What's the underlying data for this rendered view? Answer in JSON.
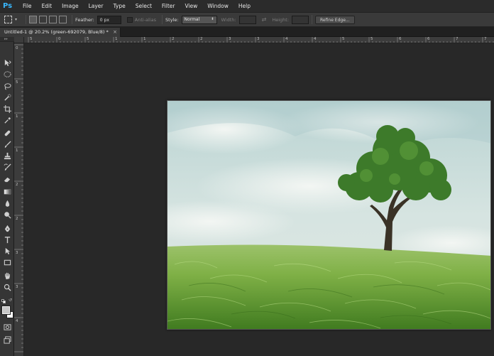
{
  "app": {
    "logo_text": "Ps",
    "accent_color": "#39b8ff"
  },
  "menu": {
    "items": [
      "File",
      "Edit",
      "Image",
      "Layer",
      "Type",
      "Select",
      "Filter",
      "View",
      "Window",
      "Help"
    ]
  },
  "options": {
    "feather_label": "Feather:",
    "feather_value": "0 px",
    "anti_alias_label": "Anti-alias",
    "style_label": "Style:",
    "style_value": "Normal",
    "width_label": "Width:",
    "height_label": "Height:",
    "refine_edge_label": "Refine Edge..."
  },
  "document_tab": {
    "title": "Untitled-1 @ 20.2% (green-692079, Blue/8) *",
    "close_glyph": "×"
  },
  "rulers": {
    "top_numbers": [
      "5",
      "0",
      "5",
      "1",
      "1",
      "2",
      "2",
      "3",
      "3",
      "4",
      "4",
      "5",
      "5",
      "6",
      "6",
      "7",
      "7"
    ],
    "left_numbers": [
      "0",
      "5",
      "1",
      "1",
      "2",
      "2",
      "3",
      "3",
      "4"
    ]
  },
  "tools": [
    {
      "name": "move-tool",
      "icon": "move-icon"
    },
    {
      "name": "marquee-tool",
      "icon": "ellipse-marquee-icon"
    },
    {
      "name": "lasso-tool",
      "icon": "lasso-icon"
    },
    {
      "name": "quick-selection-tool",
      "icon": "quick-selection-icon"
    },
    {
      "name": "crop-tool",
      "icon": "crop-icon"
    },
    {
      "name": "eyedropper-tool",
      "icon": "eyedropper-icon"
    },
    {
      "name": "healing-brush-tool",
      "icon": "bandage-icon"
    },
    {
      "name": "brush-tool",
      "icon": "brush-icon"
    },
    {
      "name": "clone-stamp-tool",
      "icon": "stamp-icon"
    },
    {
      "name": "history-brush-tool",
      "icon": "history-brush-icon"
    },
    {
      "name": "eraser-tool",
      "icon": "eraser-icon"
    },
    {
      "name": "gradient-tool",
      "icon": "gradient-icon"
    },
    {
      "name": "blur-tool",
      "icon": "droplet-icon"
    },
    {
      "name": "dodge-tool",
      "icon": "dodge-icon"
    },
    {
      "name": "pen-tool",
      "icon": "pen-icon"
    },
    {
      "name": "type-tool",
      "icon": "type-icon"
    },
    {
      "name": "path-selection-tool",
      "icon": "arrow-icon"
    },
    {
      "name": "rectangle-tool",
      "icon": "rectangle-icon"
    },
    {
      "name": "hand-tool",
      "icon": "hand-icon"
    },
    {
      "name": "zoom-tool",
      "icon": "zoom-icon"
    }
  ],
  "colors": {
    "foreground": "#c8c8c8",
    "background": "#ffffff"
  }
}
